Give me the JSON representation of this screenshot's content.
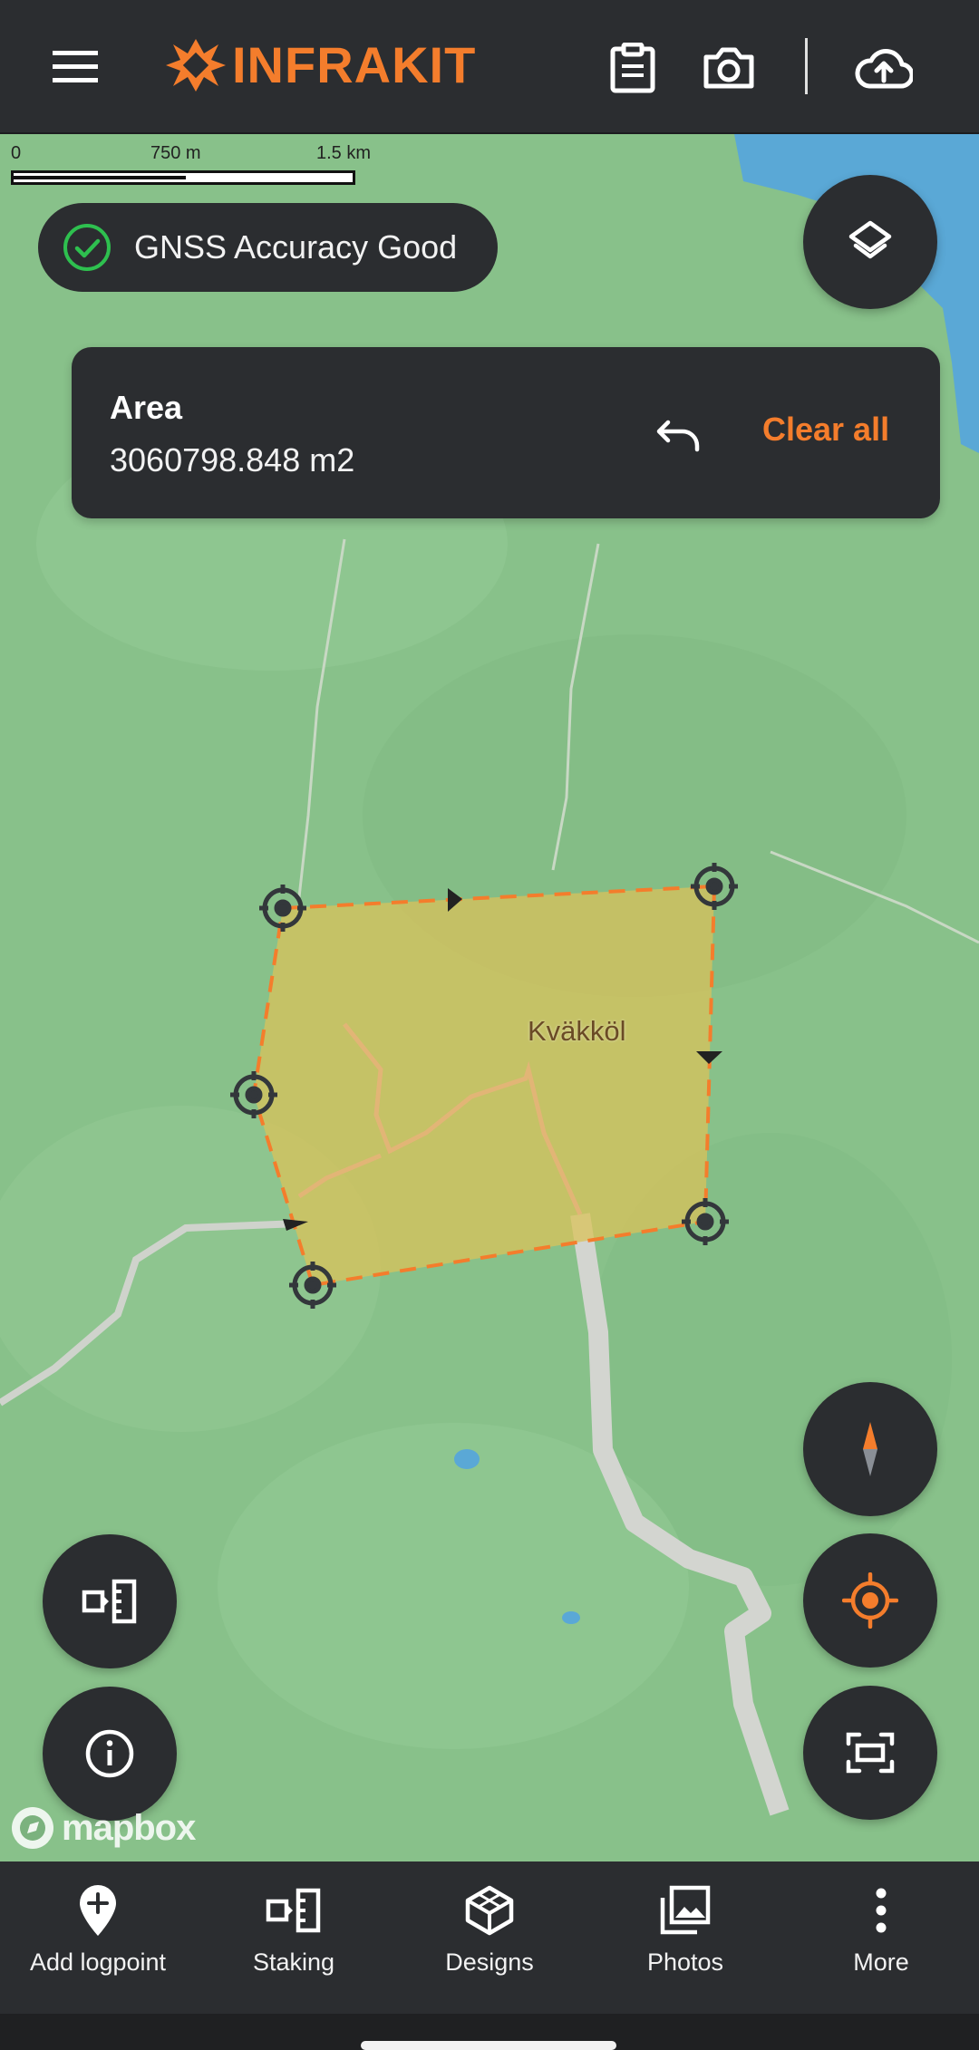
{
  "app": {
    "logo_text": "INFRAKIT",
    "brand_color": "#f47d2c",
    "bar_color": "#2b2d30"
  },
  "toolbar": {
    "menu_icon": "hamburger-menu-icon",
    "clipboard_icon": "clipboard-icon",
    "camera_icon": "camera-icon",
    "upload_icon": "cloud-upload-icon"
  },
  "scale": {
    "label_0": "0",
    "label_mid": "750 m",
    "label_max": "1.5 km"
  },
  "gnss": {
    "status": "GNSS Accuracy Good",
    "status_color": "#2ec04f"
  },
  "area_panel": {
    "title": "Area",
    "value": "3060798.848 m2",
    "clear_label": "Clear all"
  },
  "map": {
    "place_name": "Kväkköl",
    "attribution": "mapbox",
    "polygon_fill": "#d9c15a",
    "polygon_edge": "#f47d2c"
  },
  "bottom_nav": [
    {
      "label": "Add logpoint",
      "icon": "add-location-pin-icon"
    },
    {
      "label": "Staking",
      "icon": "staking-icon"
    },
    {
      "label": "Designs",
      "icon": "designs-cube-icon"
    },
    {
      "label": "Photos",
      "icon": "photos-gallery-icon"
    },
    {
      "label": "More",
      "icon": "more-vertical-icon"
    }
  ]
}
